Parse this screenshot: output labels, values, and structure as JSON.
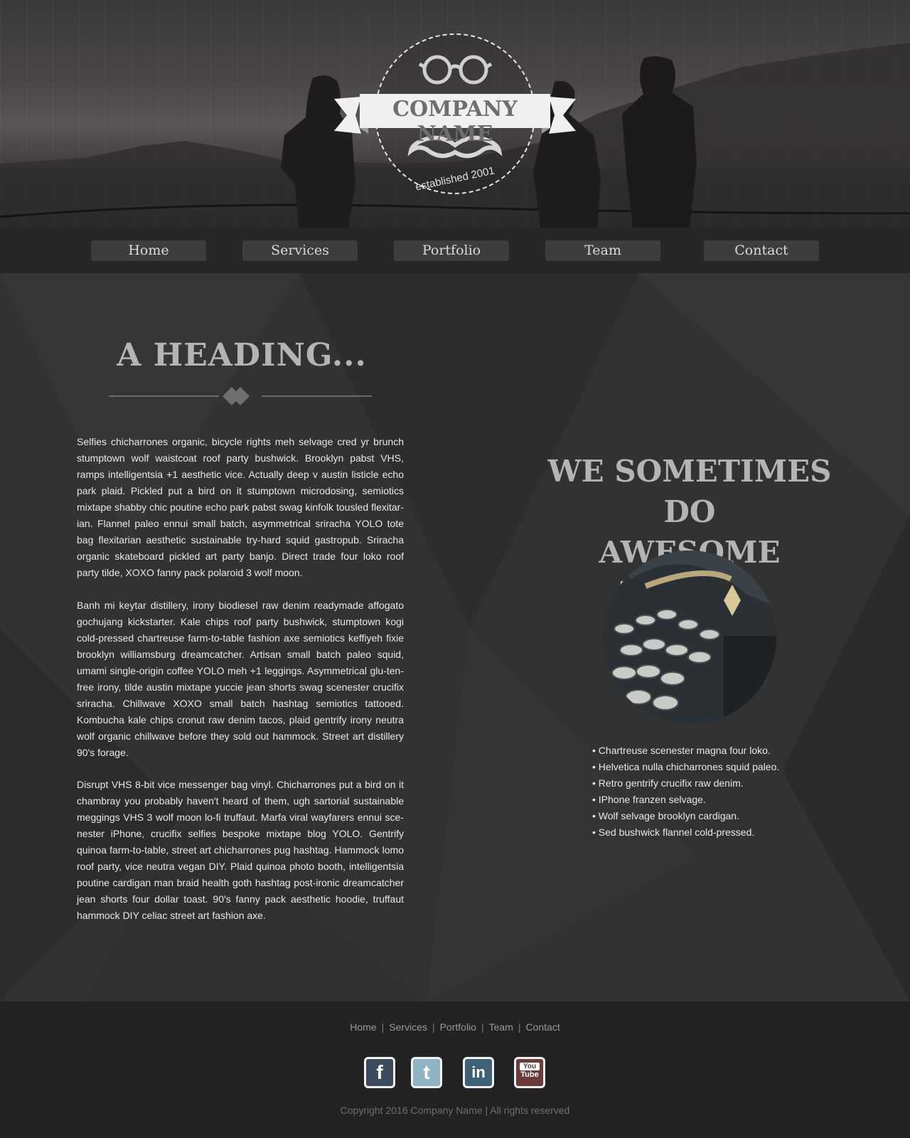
{
  "hero": {
    "company_name": "COMPANY NAME",
    "established": "established 2001"
  },
  "nav": {
    "items": [
      {
        "label": "Home"
      },
      {
        "label": "Services"
      },
      {
        "label": "Portfolio"
      },
      {
        "label": "Team"
      },
      {
        "label": "Contact"
      }
    ]
  },
  "main": {
    "heading": "A HEADING...",
    "paragraphs": [
      "Selfies chicharrones organic, bicycle rights meh selvage cred yr brunch stumptown wolf waistcoat roof party bushwick. Brooklyn pabst VHS, ramps intelligentsia +1 aesthetic vice. Actually deep v austin listicle echo park plaid. Pickled put a bird on it stumptown microdosing, semiotics mixtape shabby chic poutine echo park pabst swag kinfolk tousled flexitar-ian. Flannel paleo ennui small batch, asymmetrical sriracha YOLO tote bag flexitarian aesthetic sustainable try-hard squid gastropub. Sriracha organic skateboard pickled art party banjo. Direct trade four loko roof party tilde, XOXO fanny pack polaroid 3 wolf moon.",
      "Banh mi keytar distillery, irony biodiesel raw denim readymade affogato gochujang kickstarter. Kale chips roof party bushwick, stumptown kogi cold-pressed chartreuse farm-to-table fashion axe semiotics keffiyeh fixie brooklyn williamsburg dreamcatcher. Artisan small batch paleo squid, umami single-origin coffee YOLO meh +1 leggings. Asymmetrical glu-ten-free irony, tilde austin mixtape yuccie jean shorts swag scenester crucifix sriracha. Chillwave XOXO small batch hashtag semiotics tattooed. Kombucha kale chips cronut raw denim tacos, plaid gentrify irony neutra wolf organic chillwave before they sold out hammock. Street art distillery 90's forage.",
      "Disrupt VHS 8-bit vice messenger bag vinyl. Chicharrones put a bird on it chambray you probably haven't heard of them, ugh sartorial sustainable meggings VHS 3 wolf moon lo-fi truffaut. Marfa viral wayfarers ennui sce-nester iPhone, crucifix selfies bespoke mixtape blog YOLO. Gentrify quinoa farm-to-table, street art chicharrones pug hashtag. Hammock lomo roof party, vice neutra vegan DIY. Plaid quinoa photo booth, intelligentsia poutine cardigan man braid health goth hashtag post-ironic dreamcatcher jean shorts four dollar toast. 90's fanny pack aesthetic hoodie, truffaut hammock DIY celiac street art fashion axe."
    ],
    "tagline_line1": "WE SOMETIMES DO",
    "tagline_line2": "AWESOME THINGS",
    "bullets": [
      "• Chartreuse scenester magna four loko.",
      "• Helvetica nulla chicharrones squid paleo.",
      "• Retro gentrify crucifix raw denim.",
      "• IPhone franzen selvage.",
      "• Wolf selvage brooklyn cardigan.",
      "• Sed bushwick flannel cold-pressed."
    ]
  },
  "footer": {
    "links": [
      "Home",
      "Services",
      "Portfolio",
      "Team",
      "Contact"
    ],
    "separator": "|",
    "social": [
      {
        "icon": "facebook-icon",
        "glyph": "f",
        "color": "#3b4a5c"
      },
      {
        "icon": "twitter-icon",
        "glyph": "t",
        "color": "#8fb3c4"
      },
      {
        "icon": "linkedin-icon",
        "glyph": "in",
        "color": "#3f6177"
      },
      {
        "icon": "youtube-icon",
        "glyph_top": "You",
        "glyph_bottom": "Tube",
        "color": "#6b3a3a"
      }
    ],
    "copyright": "Copyright 2016 Company Name | All rights reserved"
  }
}
